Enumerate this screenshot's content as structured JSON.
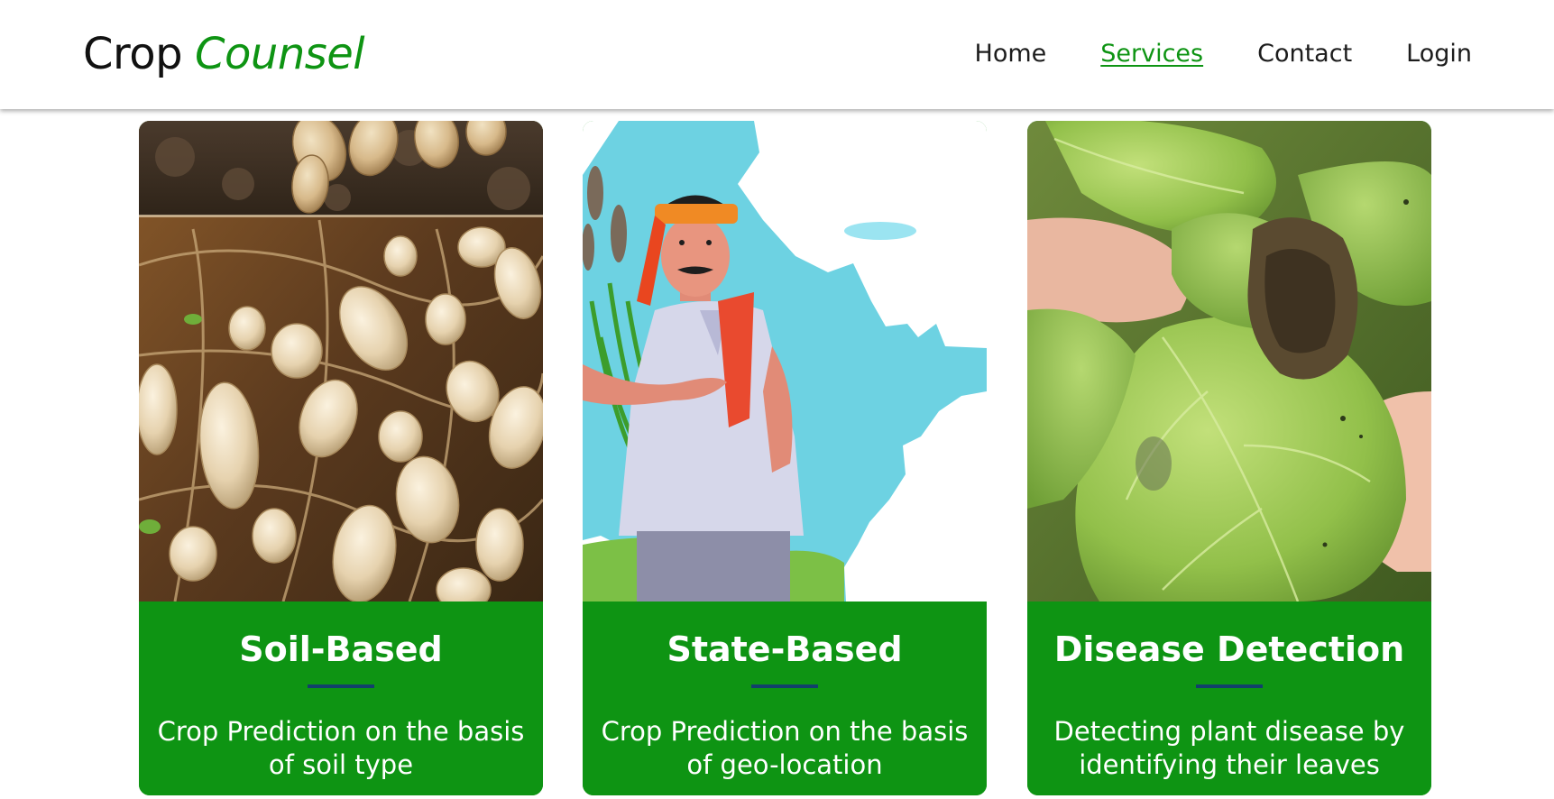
{
  "brand": {
    "name_part1": "Crop",
    "name_part2": "Counsel"
  },
  "nav": {
    "items": [
      {
        "label": "Home",
        "active": false
      },
      {
        "label": "Services",
        "active": true
      },
      {
        "label": "Contact",
        "active": false
      },
      {
        "label": "Login",
        "active": false
      }
    ]
  },
  "cards": [
    {
      "title": "Soil-Based",
      "description": "Crop Prediction on the basis of soil type",
      "image_subject": "harvested peanuts with roots"
    },
    {
      "title": "State-Based",
      "description": "Crop Prediction on the basis of geo-location",
      "image_subject": "farmer illustration in front of map"
    },
    {
      "title": "Disease Detection",
      "description": "Detecting plant disease by identifying their leaves",
      "image_subject": "hand holding diseased leaf"
    }
  ],
  "colors": {
    "accent": "#0e9413",
    "card_divider": "#123f6b",
    "text_dark": "#111111",
    "card_text": "#ffffff"
  }
}
